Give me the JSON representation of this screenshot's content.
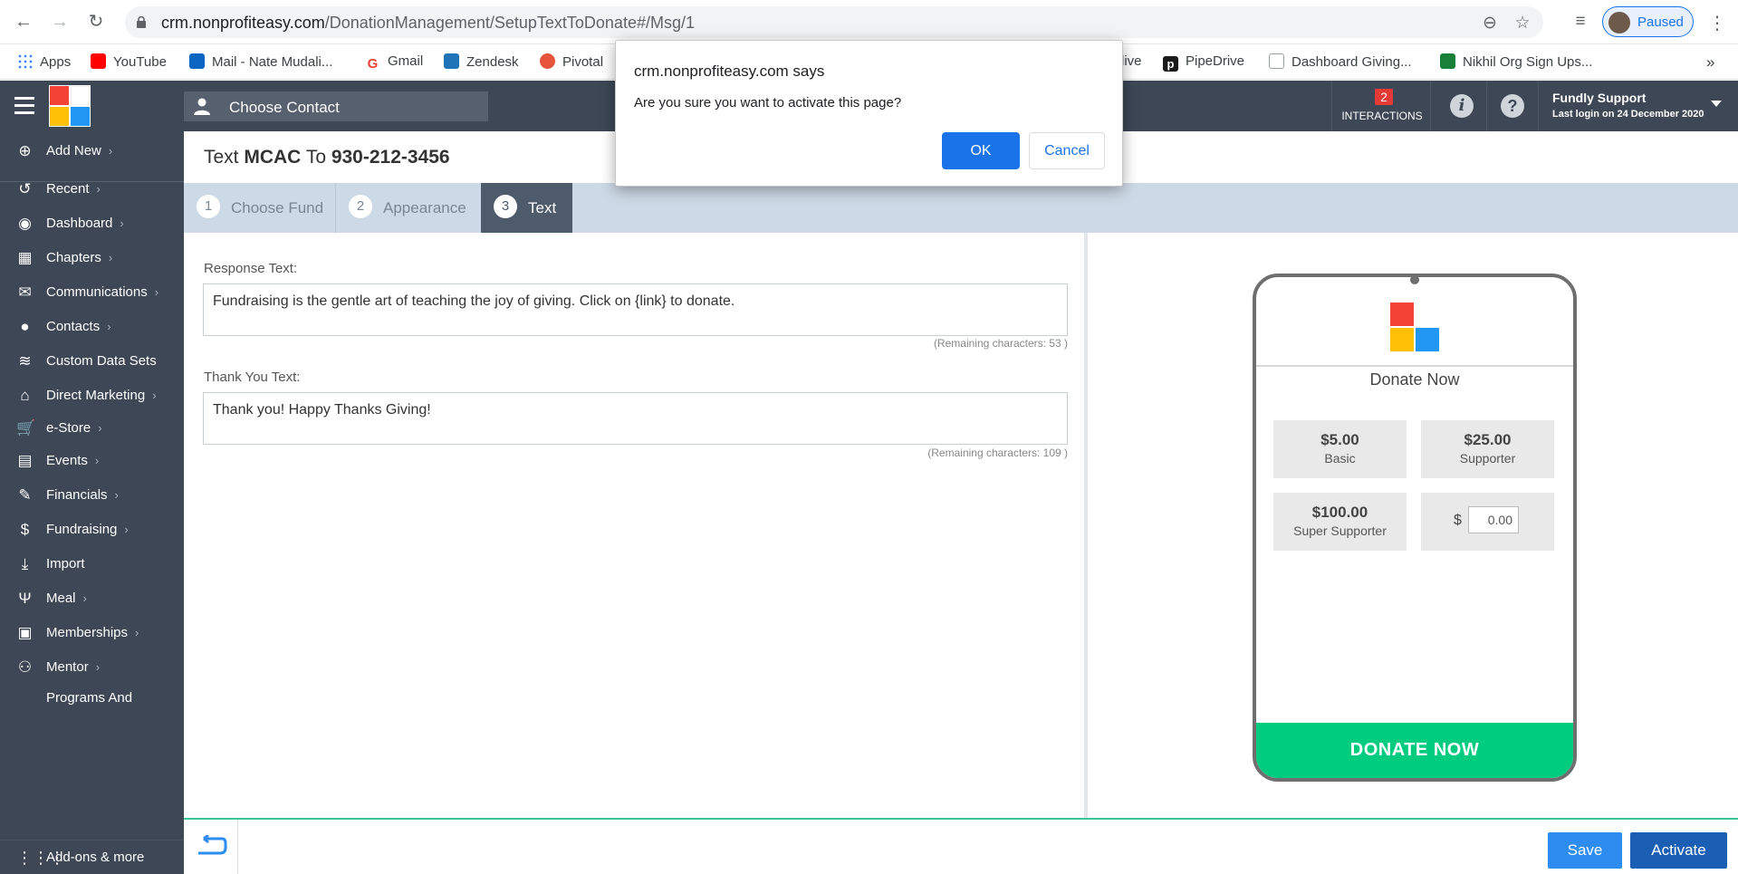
{
  "browser": {
    "url_host": "crm.nonprofiteasy.com",
    "url_path": "/DonationManagement/SetupTextToDonate#/Msg/1",
    "profile_label": "Paused",
    "bookmarks": [
      {
        "label": "Apps",
        "color": "#4285f4"
      },
      {
        "label": "YouTube",
        "color": "#ff0000"
      },
      {
        "label": "Mail - Nate Mudali...",
        "color": "#0a66c2"
      },
      {
        "label": "Gmail",
        "color": "#ea4335"
      },
      {
        "label": "Zendesk",
        "color": "#1f73b7"
      },
      {
        "label": "Pivotal",
        "color": "#e8533c"
      },
      {
        "label": "live",
        "color": "#ffffff"
      },
      {
        "label": "PipeDrive",
        "color": "#1a1a1a"
      },
      {
        "label": "Dashboard Giving...",
        "color": "#9aa0a6"
      },
      {
        "label": "Nikhil Org Sign Ups...",
        "color": "#188038"
      }
    ],
    "bookmarks_overflow": "»"
  },
  "header": {
    "choose_contact": "Choose Contact",
    "interactions_count": "2",
    "interactions_label": "INTERACTIONS",
    "info_icon": "i",
    "help_icon": "?",
    "user_name": "Fundly Support",
    "last_login": "Last login on 24 December 2020"
  },
  "sidebar": {
    "items": [
      {
        "label": "Add New",
        "icon": "plus-circle-icon",
        "glyph": "⊕",
        "chevron": true
      },
      {
        "label": "Recent",
        "icon": "history-icon",
        "glyph": "↺",
        "chevron": true
      },
      {
        "label": "Dashboard",
        "icon": "palette-icon",
        "glyph": "◉",
        "chevron": true
      },
      {
        "label": "Chapters",
        "icon": "grid-icon",
        "glyph": "▦",
        "chevron": true
      },
      {
        "label": "Communications",
        "icon": "envelope-icon",
        "glyph": "✉",
        "chevron": true
      },
      {
        "label": "Contacts",
        "icon": "user-icon",
        "glyph": "●",
        "chevron": true
      },
      {
        "label": "Custom Data Sets",
        "icon": "layers-icon",
        "glyph": "≋",
        "chevron": false
      },
      {
        "label": "Direct Marketing",
        "icon": "home-icon",
        "glyph": "⌂",
        "chevron": true
      },
      {
        "label": "e-Store",
        "icon": "cart-icon",
        "glyph": "🛒",
        "chevron": true
      },
      {
        "label": "Events",
        "icon": "calendar-icon",
        "glyph": "▤",
        "chevron": true
      },
      {
        "label": "Financials",
        "icon": "money-icon",
        "glyph": "✎",
        "chevron": true
      },
      {
        "label": "Fundraising",
        "icon": "moneybag-icon",
        "glyph": "$",
        "chevron": true
      },
      {
        "label": "Import",
        "icon": "download-icon",
        "glyph": "⤓",
        "chevron": false
      },
      {
        "label": "Meal",
        "icon": "utensils-icon",
        "glyph": "Ψ",
        "chevron": true
      },
      {
        "label": "Memberships",
        "icon": "id-card-icon",
        "glyph": "▣",
        "chevron": true
      },
      {
        "label": "Mentor",
        "icon": "people-icon",
        "glyph": "⚇",
        "chevron": true
      },
      {
        "label": "Programs And",
        "icon": "",
        "glyph": "",
        "chevron": false
      }
    ],
    "addons_label": "Add-ons & more"
  },
  "page": {
    "title_prefix": "Text ",
    "title_keyword": "MCAC",
    "title_middle": " To ",
    "title_number": "930-212-3456"
  },
  "steps": [
    {
      "num": "1",
      "label": "Choose Fund",
      "active": false
    },
    {
      "num": "2",
      "label": "Appearance",
      "active": false
    },
    {
      "num": "3",
      "label": "Text",
      "active": true
    }
  ],
  "form": {
    "response_label": "Response Text:",
    "response_value": "Fundraising is the gentle art of teaching the joy of giving. Click on {link} to donate.",
    "response_remaining": "(Remaining characters: 53 )",
    "thankyou_label": "Thank You Text:",
    "thankyou_value": "Thank you! Happy Thanks Giving!",
    "thankyou_remaining": "(Remaining characters: 109 )"
  },
  "preview": {
    "title": "Donate Now",
    "amounts": [
      {
        "value": "$5.00",
        "name": "Basic"
      },
      {
        "value": "$25.00",
        "name": "Supporter"
      },
      {
        "value": "$100.00",
        "name": "Super Supporter"
      }
    ],
    "custom_currency": "$",
    "custom_value": "0.00",
    "donate_button": "DONATE NOW"
  },
  "footer": {
    "save": "Save",
    "activate": "Activate"
  },
  "dialog": {
    "title": "crm.nonprofiteasy.com says",
    "message": "Are you sure you want to activate this page?",
    "ok": "OK",
    "cancel": "Cancel"
  },
  "colors": {
    "header_bg": "#3d4755",
    "stepbar_bg": "#cdd9e6",
    "active_step": "#4e5b6b",
    "donate_green": "#00cc80",
    "save_blue": "#2d8cf0",
    "activate_blue": "#1a5fb4"
  }
}
